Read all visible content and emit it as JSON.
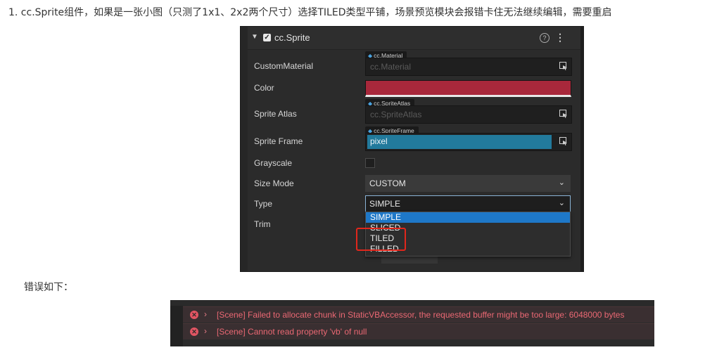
{
  "article": {
    "heading": "1. cc.Sprite组件，如果是一张小图（只测了1x1、2x2两个尺寸）选择TILED类型平铺，场景预览模块会报错卡住无法继续编辑，需要重启",
    "error_intro": "错误如下："
  },
  "inspector": {
    "component_title": "cc.Sprite",
    "enabled": true,
    "icons": {
      "collapse": "chevron-down-icon",
      "help": "help-icon",
      "menu": "more-vertical-icon",
      "picker": "asset-picker-icon"
    },
    "properties": {
      "custom_material": {
        "label": "CustomMaterial",
        "tag": "cc.Material",
        "placeholder": "cc.Material"
      },
      "color": {
        "label": "Color",
        "value_hex": "#a8283b"
      },
      "sprite_atlas": {
        "label": "Sprite Atlas",
        "tag": "cc.SpriteAtlas",
        "placeholder": "cc.SpriteAtlas"
      },
      "sprite_frame": {
        "label": "Sprite Frame",
        "tag": "cc.SpriteFrame",
        "value": "pixel"
      },
      "grayscale": {
        "label": "Grayscale",
        "checked": false
      },
      "size_mode": {
        "label": "Size Mode",
        "value": "CUSTOM"
      },
      "type": {
        "label": "Type",
        "value": "SIMPLE",
        "options": [
          "SIMPLE",
          "SLICED",
          "TILED",
          "FILLED"
        ],
        "highlighted_option": "TILED"
      },
      "trim": {
        "label": "Trim"
      }
    },
    "colors": {
      "panel_bg": "#2b2b2b",
      "selection": "#1e78c8",
      "annotation_box": "#e0271c"
    }
  },
  "console": {
    "errors": [
      {
        "text": "[Scene] Failed to allocate chunk in StaticVBAccessor, the requested buffer might be too large: 6048000 bytes"
      },
      {
        "text": "[Scene] Cannot read property 'vb' of null"
      }
    ],
    "error_color": "#ea6873"
  }
}
